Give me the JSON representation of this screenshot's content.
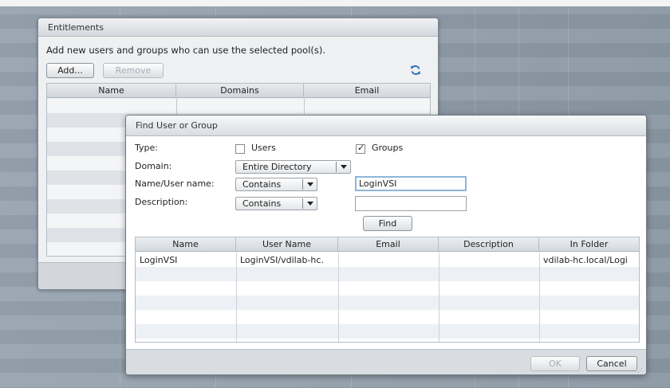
{
  "entitlements": {
    "title": "Entitlements",
    "description": "Add new users and groups who can use the selected pool(s).",
    "add_label": "Add...",
    "remove_label": "Remove",
    "columns": [
      "Name",
      "Domains",
      "Email"
    ]
  },
  "find_dialog": {
    "title": "Find User or Group",
    "type_label": "Type:",
    "users_label": "Users",
    "users_checked": false,
    "groups_label": "Groups",
    "groups_checked": true,
    "domain_label": "Domain:",
    "domain_value": "Entire Directory",
    "name_label": "Name/User name:",
    "name_operator": "Contains",
    "name_value": "LoginVSI",
    "description_label": "Description:",
    "description_operator": "Contains",
    "description_value": "",
    "find_label": "Find",
    "results": {
      "columns": [
        "Name",
        "User Name",
        "Email",
        "Description",
        "In Folder"
      ],
      "rows": [
        {
          "name": "LoginVSI",
          "user_name": "LoginVSI/vdilab-hc.",
          "email": "",
          "description": "",
          "in_folder": "vdilab-hc.local/Logi"
        }
      ]
    },
    "ok_label": "OK",
    "cancel_label": "Cancel"
  },
  "colors": {
    "accent_focus": "#8fb5dc",
    "refresh_icon": "#2f6fb8"
  },
  "icons": [
    "refresh-icon",
    "checkbox-icon",
    "dropdown-caret-icon",
    "resize-grip-icon"
  ]
}
